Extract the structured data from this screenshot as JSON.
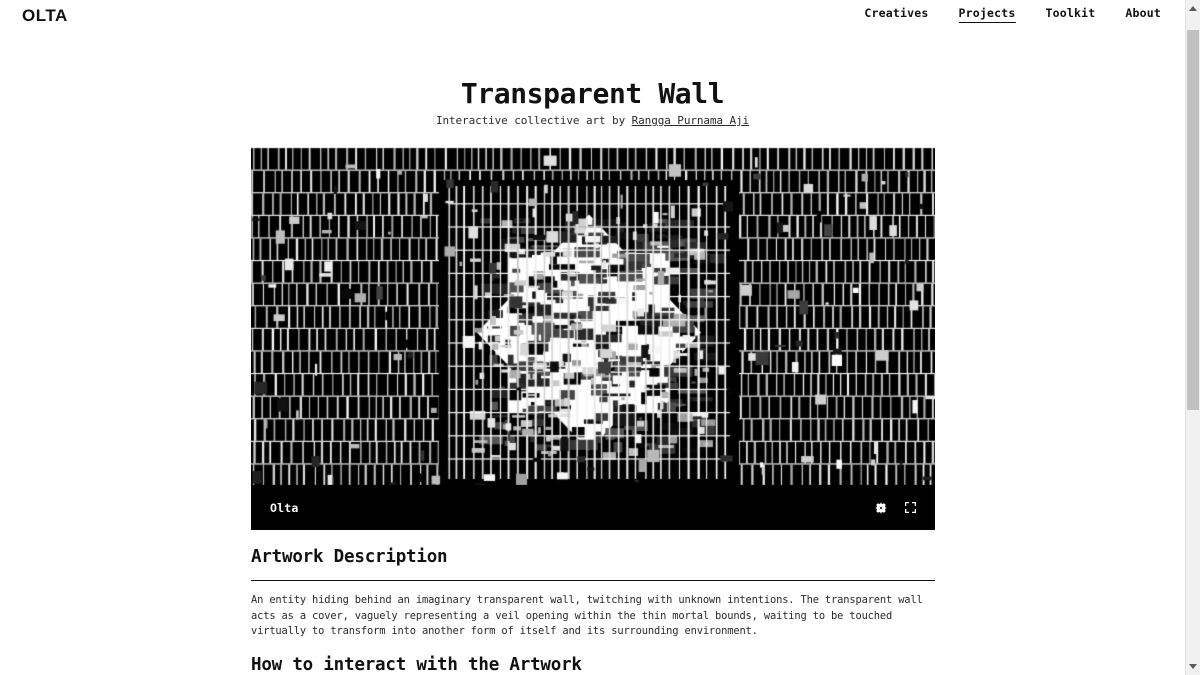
{
  "header": {
    "brand": "OLTA",
    "nav": [
      {
        "label": "Creatives",
        "active": false
      },
      {
        "label": "Projects",
        "active": true
      },
      {
        "label": "Toolkit",
        "active": false
      },
      {
        "label": "About",
        "active": false
      }
    ]
  },
  "artwork": {
    "title": "Transparent Wall",
    "byline_prefix": "Interactive collective art by ",
    "artist": "Rangga Purnama Aji",
    "watermark": "Olta",
    "controls": [
      {
        "name": "gear-icon",
        "label": "Settings"
      },
      {
        "name": "fullscreen-icon",
        "label": "Fullscreen"
      }
    ]
  },
  "sections": [
    {
      "heading": "Artwork Description",
      "body": "An entity hiding behind an imaginary transparent wall, twitching with unknown intentions. The transparent wall acts as a cover, vaguely representing a veil opening within the thin mortal bounds, waiting to be touched virtually to transform into another form of itself and its surrounding environment."
    },
    {
      "heading": "How to interact with the Artwork",
      "body": ""
    }
  ],
  "colors": {
    "background": "#ffffff",
    "text": "#111111",
    "artwork_black": "#000000",
    "artwork_white": "#ffffff",
    "scrollbar_track": "#f1f1f1",
    "scrollbar_thumb": "#c1c1c1"
  },
  "scrollbar": {
    "up_arrow": "scroll-up",
    "down_arrow": "scroll-down",
    "thumb": "scroll-thumb"
  }
}
